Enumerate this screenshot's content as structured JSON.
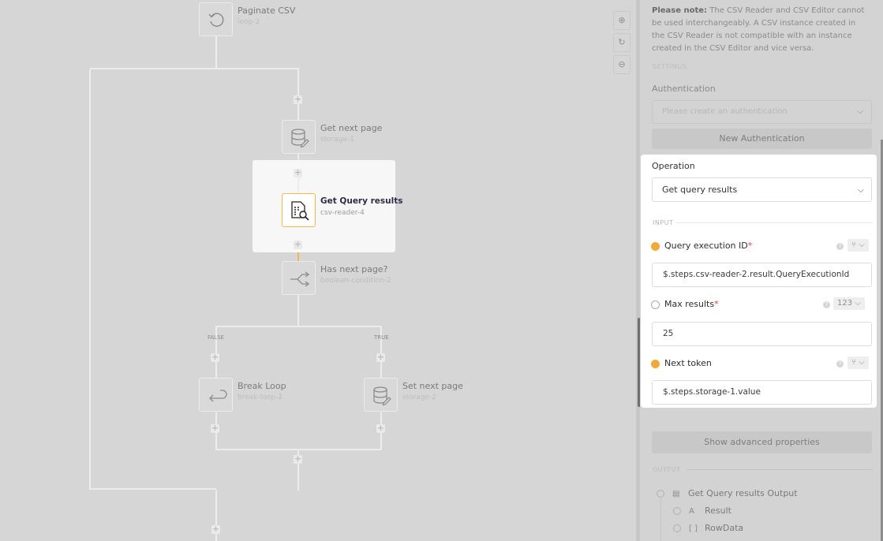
{
  "canvas": {
    "nodes": {
      "paginate": {
        "title": "Paginate CSV",
        "sub": "loop-2"
      },
      "get_next": {
        "title": "Get next page",
        "sub": "storage-1"
      },
      "get_query": {
        "title": "Get Query results",
        "sub": "csv-reader-4"
      },
      "has_next": {
        "title": "Has next page?",
        "sub": "boolean-condition-2"
      },
      "break_loop": {
        "title": "Break Loop",
        "sub": "break-loop-2"
      },
      "set_next": {
        "title": "Set next page",
        "sub": "storage-2"
      }
    },
    "branch_false": "FALSE",
    "branch_true": "TRUE"
  },
  "panel": {
    "note_strong": "Please note:",
    "note_text": " The CSV Reader and CSV Editor cannot be used interchangeably. A CSV instance created in the CSV Reader is not compatible with an instance created in the CSV Editor and vice versa.",
    "settings_title": "SETTINGS",
    "auth_label": "Authentication",
    "auth_placeholder": "Please create an authentication",
    "new_auth_button": "New Authentication",
    "operation_label": "Operation",
    "operation_value": "Get query results",
    "input_title": "INPUT",
    "fields": {
      "query_id": {
        "label": "Query execution ID",
        "value": "$.steps.csv-reader-2.result.QueryExecutionId"
      },
      "max_results": {
        "label": "Max results",
        "value": "25",
        "type": "123"
      },
      "next_token": {
        "label": "Next token",
        "value": "$.steps.storage-1.value"
      }
    },
    "show_advanced": "Show advanced properties",
    "output_title": "OUTPUT",
    "output": {
      "root": "Get Query results Output",
      "result": "Result",
      "rowdata": "RowData"
    }
  },
  "icons": {
    "required_mark": "*"
  }
}
